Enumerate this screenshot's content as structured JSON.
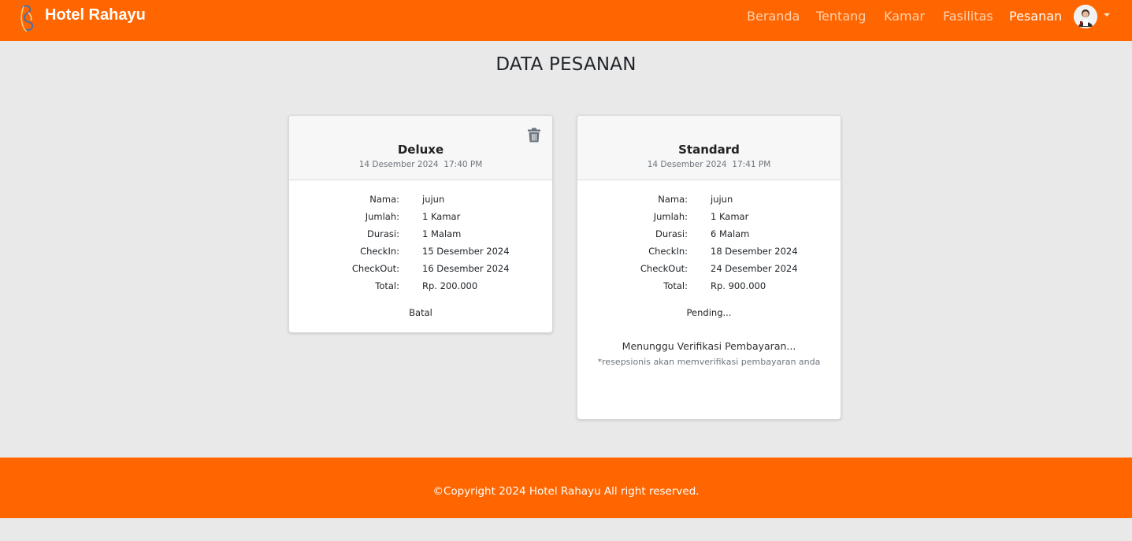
{
  "brand": {
    "name": "Hotel Rahayu",
    "logo_icon": "hotel-logo-icon"
  },
  "nav": {
    "items": [
      {
        "label": "Beranda",
        "active": false
      },
      {
        "label": "Tentang",
        "active": false
      },
      {
        "label": "Kamar",
        "active": false
      },
      {
        "label": "Fasilitas",
        "active": false
      },
      {
        "label": "Pesanan",
        "active": true
      }
    ],
    "avatar_icon": "user-avatar",
    "dropdown_icon": "caret-down-icon"
  },
  "page": {
    "title": "DATA PESANAN"
  },
  "orders": [
    {
      "room_type": "Deluxe",
      "date": "14 Desember 2024",
      "time": "17:40 PM",
      "fields": [
        {
          "label": "Nama:",
          "value": "jujun"
        },
        {
          "label": "Jumlah:",
          "value": "1 Kamar"
        },
        {
          "label": "Durasi:",
          "value": "1 Malam"
        },
        {
          "label": "CheckIn:",
          "value": "15 Desember 2024"
        },
        {
          "label": "CheckOut:",
          "value": "16 Desember 2024"
        },
        {
          "label": "Total:",
          "value": "Rp. 200.000"
        }
      ],
      "status": "Batal",
      "delete_icon": "trash-icon"
    },
    {
      "room_type": "Standard",
      "date": "14 Desember 2024",
      "time": "17:41 PM",
      "fields": [
        {
          "label": "Nama:",
          "value": "jujun"
        },
        {
          "label": "Jumlah:",
          "value": "1 Kamar"
        },
        {
          "label": "Durasi:",
          "value": "6 Malam"
        },
        {
          "label": "CheckIn:",
          "value": "18 Desember 2024"
        },
        {
          "label": "CheckOut:",
          "value": "24 Desember 2024"
        },
        {
          "label": "Total:",
          "value": "Rp. 900.000"
        }
      ],
      "status": "Pending...",
      "waiting": "Menunggu Verifikasi Pembayaran...",
      "waiting_note": "*resepsionis akan memverifikasi pembayaran anda"
    }
  ],
  "footer": {
    "text": "©Copyright 2024 Hotel Rahayu All right reserved."
  },
  "colors": {
    "primary": "#ff6600",
    "background": "#e9e9e9",
    "card": "#ffffff"
  }
}
